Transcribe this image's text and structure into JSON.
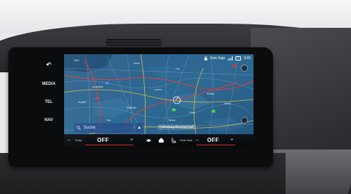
{
  "side_buttons": {
    "back_label": "↶",
    "media_label": "MEDIA",
    "tel_label": "TEL",
    "nav_label": "NAV"
  },
  "status_bar": {
    "signal_text": "Kein Sign",
    "time": "9:55"
  },
  "map": {
    "search_placeholder": "Suche",
    "destination_label": "Fahrzeug-Bereitschaft"
  },
  "climate_bar": {
    "left_label": "Temp.",
    "left_value": "OFF",
    "right_label": "Heat Seat",
    "right_value": "OFF",
    "minus": "–",
    "plus": "+"
  },
  "colors": {
    "map_water": "#1f4f7a",
    "map_land": "#2a5f86",
    "road_red": "#e23b3b",
    "road_yellow": "#f0c63c",
    "accent_red": "#d32c2c"
  }
}
